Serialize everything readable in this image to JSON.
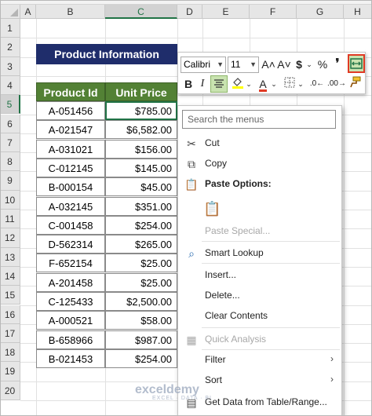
{
  "columns": [
    "A",
    "B",
    "C",
    "D",
    "E",
    "F",
    "G",
    "H"
  ],
  "selected_column": "C",
  "rows": [
    "1",
    "2",
    "3",
    "4",
    "5",
    "6",
    "7",
    "8",
    "9",
    "10",
    "11",
    "12",
    "13",
    "14",
    "15",
    "16",
    "17",
    "18",
    "19",
    "20"
  ],
  "selected_row": "5",
  "title": "Product Information",
  "table": {
    "headers": [
      "Product Id",
      "Unit Price"
    ],
    "rows": [
      {
        "id": "A-051456",
        "price": "$785.00"
      },
      {
        "id": "A-021547",
        "price": "$6,582.00"
      },
      {
        "id": "A-031021",
        "price": "$156.00"
      },
      {
        "id": "C-012145",
        "price": "$145.00"
      },
      {
        "id": "B-000154",
        "price": "$45.00"
      },
      {
        "id": "A-032145",
        "price": "$351.00"
      },
      {
        "id": "C-001458",
        "price": "$254.00"
      },
      {
        "id": "D-562314",
        "price": "$265.00"
      },
      {
        "id": "F-652154",
        "price": "$25.00"
      },
      {
        "id": "A-201458",
        "price": "$25.00"
      },
      {
        "id": "C-125433",
        "price": "$2,500.00"
      },
      {
        "id": "A-000521",
        "price": "$58.00"
      },
      {
        "id": "B-658966",
        "price": "$987.00"
      },
      {
        "id": "B-021453",
        "price": "$254.00"
      }
    ]
  },
  "mini_toolbar": {
    "font_name": "Calibri",
    "font_size": "11",
    "increase_font": "A˄",
    "decrease_font": "A˅",
    "currency": "$",
    "percent": "%",
    "comma": "̹",
    "bold": "B",
    "italic": "I",
    "font_color": "A"
  },
  "context_menu": {
    "search_placeholder": "Search the menus",
    "cut": "Cut",
    "copy": "Copy",
    "paste_options": "Paste Options:",
    "paste_special": "Paste Special...",
    "smart_lookup": "Smart Lookup",
    "insert": "Insert...",
    "delete": "Delete...",
    "clear_contents": "Clear Contents",
    "quick_analysis": "Quick Analysis",
    "filter": "Filter",
    "sort": "Sort",
    "get_data": "Get Data from Table/Range..."
  },
  "watermark": {
    "brand": "exceldemy",
    "tagline": "EXCEL · DATA · BI"
  },
  "colors": {
    "title_bg": "#1f2d6b",
    "header_bg": "#538135",
    "selection": "#217346",
    "highlight_button": "#c9e3b0"
  }
}
